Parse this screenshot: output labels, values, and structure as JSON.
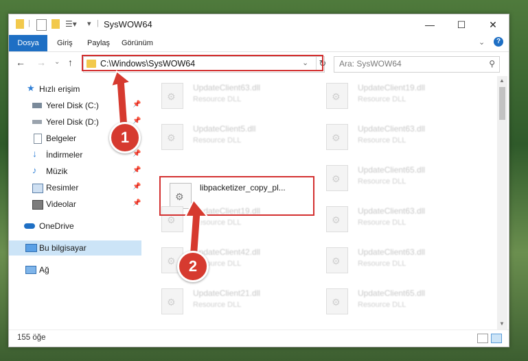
{
  "window": {
    "title": "SysWOW64",
    "tabs": [
      "Dosya",
      "Giriş",
      "Paylaş",
      "Görünüm"
    ]
  },
  "address": {
    "path": "C:\\Windows\\SysWOW64",
    "search_placeholder": "Ara: SysWOW64"
  },
  "sidebar": {
    "items": [
      {
        "label": "Hızlı erişim"
      },
      {
        "label": "Yerel Disk (C:)"
      },
      {
        "label": "Yerel Disk (D:)"
      },
      {
        "label": "Belgeler"
      },
      {
        "label": "İndirmeler"
      },
      {
        "label": "Müzik"
      },
      {
        "label": "Resimler"
      },
      {
        "label": "Videolar"
      },
      {
        "label": "OneDrive"
      },
      {
        "label": "Bu bilgisayar"
      },
      {
        "label": "Ağ"
      }
    ]
  },
  "files": [
    {
      "name": "UpdateClient63.dll",
      "desc": "Resource DLL"
    },
    {
      "name": "UpdateClient19.dll",
      "desc": "Resource DLL"
    },
    {
      "name": "UpdateClient5.dll",
      "desc": "Resource DLL"
    },
    {
      "name": "UpdateClient63.dll",
      "desc": "Resource DLL"
    },
    {
      "name": "libpacketizer_copy_pl...",
      "desc": ""
    },
    {
      "name": "UpdateClient65.dll",
      "desc": "Resource DLL"
    },
    {
      "name": "UpdateClient19.dll",
      "desc": "Resource DLL"
    },
    {
      "name": "UpdateClient63.dll",
      "desc": "Resource DLL"
    },
    {
      "name": "UpdateClient42.dll",
      "desc": "Resource DLL"
    },
    {
      "name": "UpdateClient63.dll",
      "desc": "Resource DLL"
    },
    {
      "name": "UpdateClient21.dll",
      "desc": "Resource DLL"
    },
    {
      "name": "UpdateClient65.dll",
      "desc": "Resource DLL"
    }
  ],
  "status": {
    "count": "155 öğe"
  },
  "annotations": {
    "step1": "1",
    "step2": "2"
  },
  "colors": {
    "accent": "#1e6fc4",
    "highlight": "#d32f2f",
    "badge": "#d63a2f"
  }
}
